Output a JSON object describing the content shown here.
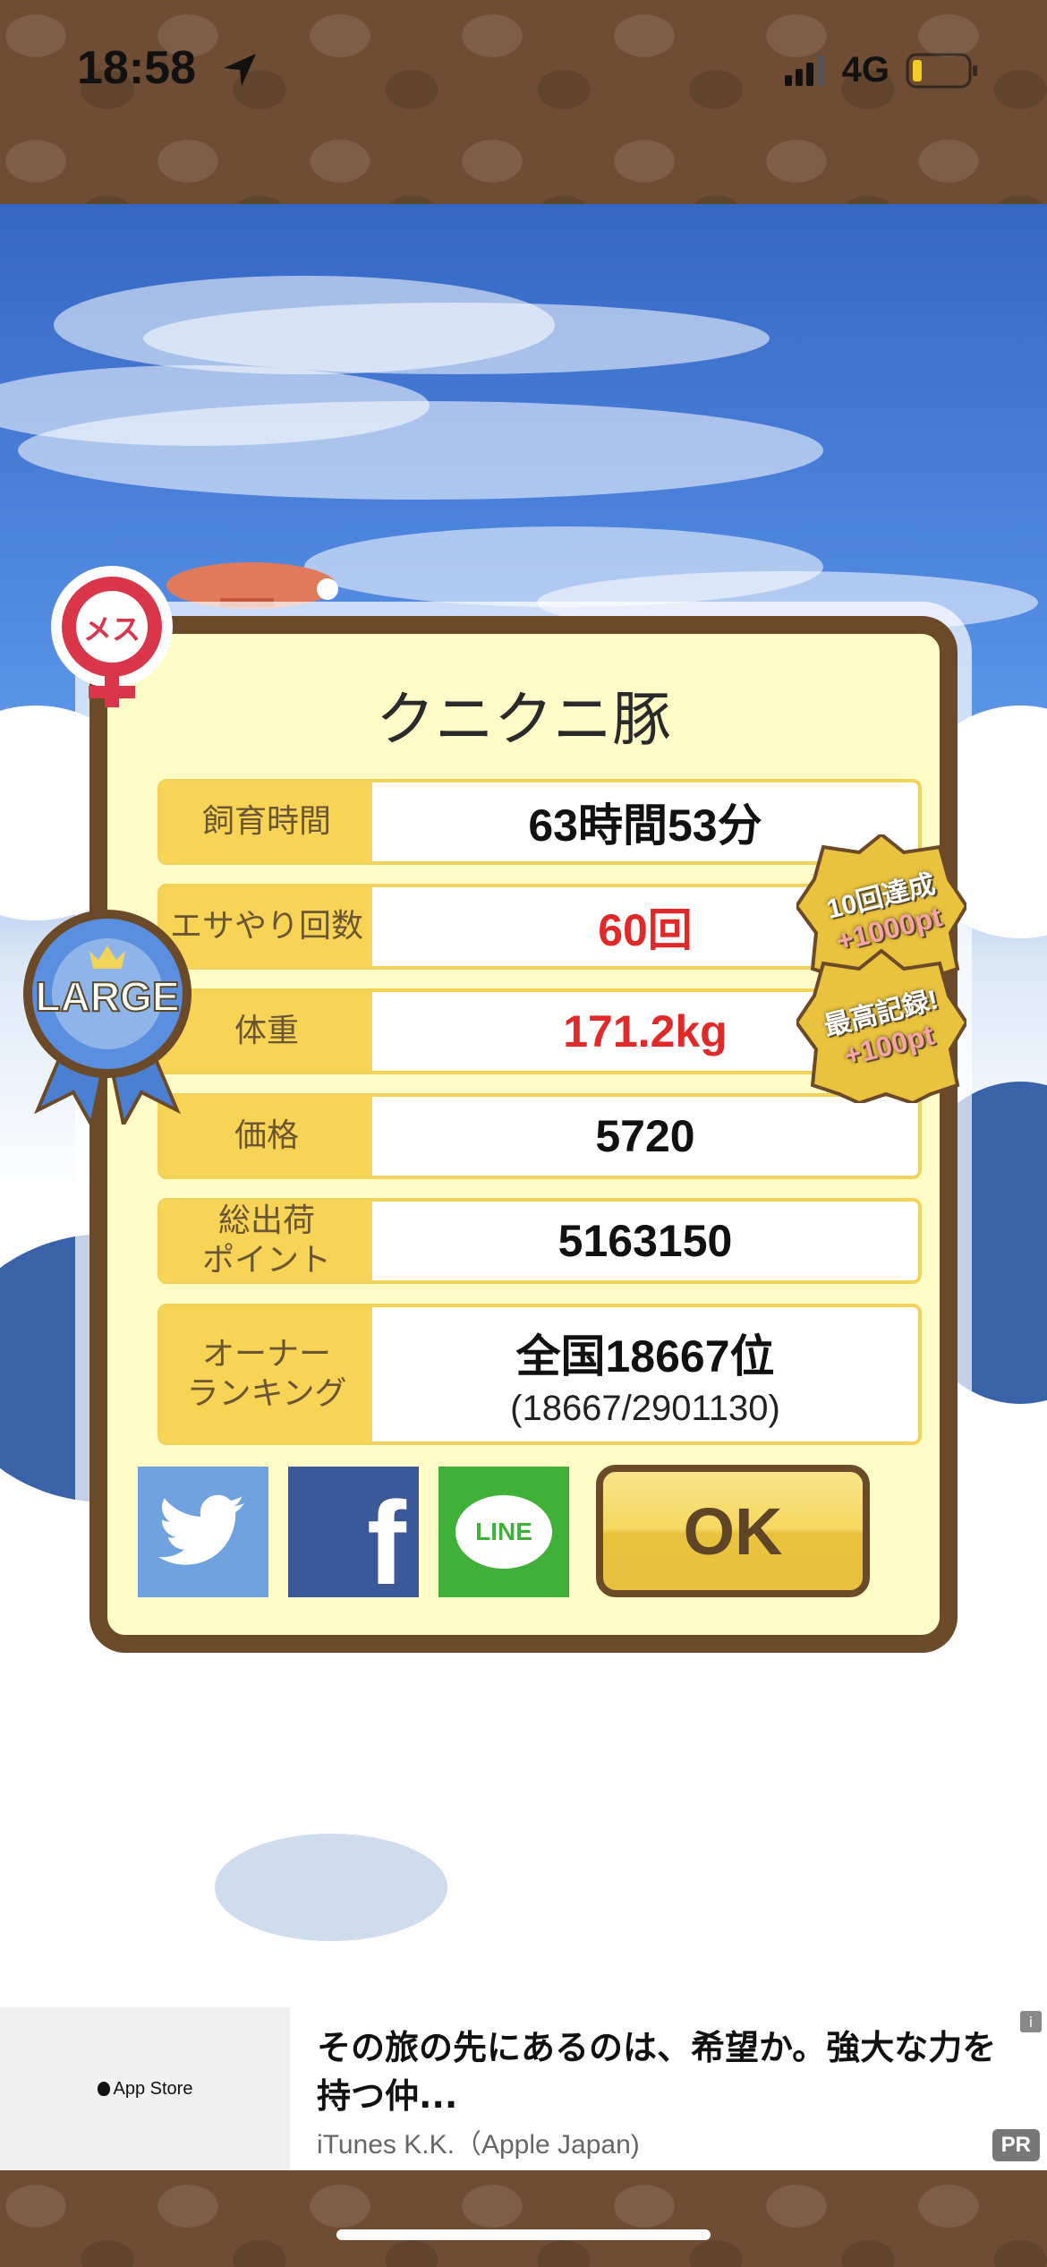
{
  "status_bar": {
    "time": "18:58",
    "network": "4G"
  },
  "pig": {
    "gender_label": "メス",
    "name": "クニクニ豚",
    "size_badge": "LARGE"
  },
  "stats": [
    {
      "label": "飼育時間",
      "value": "63時間53分",
      "highlight": false
    },
    {
      "label": "エサやり回数",
      "value": "60回",
      "highlight": true
    },
    {
      "label": "体重",
      "value": "171.2kg",
      "highlight": true
    },
    {
      "label": "価格",
      "value": "5720",
      "highlight": false
    },
    {
      "label": "総出荷\nポイント",
      "value": "5163150",
      "highlight": false
    },
    {
      "label": "オーナー\nランキング",
      "value": "全国18667位",
      "sub": "(18667/2901130)",
      "highlight": false
    }
  ],
  "achievements": [
    {
      "line1": "10回達成",
      "line2": "+1000pt"
    },
    {
      "line1": "最高記録!",
      "line2": "+100pt"
    }
  ],
  "share": {
    "twitter": "twitter-share",
    "facebook": "f",
    "line": "LINE"
  },
  "ok_label": "OK",
  "ad": {
    "store_label": "App Store",
    "headline": "その旅の先にあるのは、希望か。強大な力を持つ仲...",
    "advertiser": "iTunes K.K.（Apple Japan)",
    "pr": "PR",
    "info": "i"
  },
  "colors": {
    "accent": "#f7d456",
    "frame": "#6b4a2a",
    "highlight": "#e02a2a",
    "panel": "#fffcc8"
  }
}
